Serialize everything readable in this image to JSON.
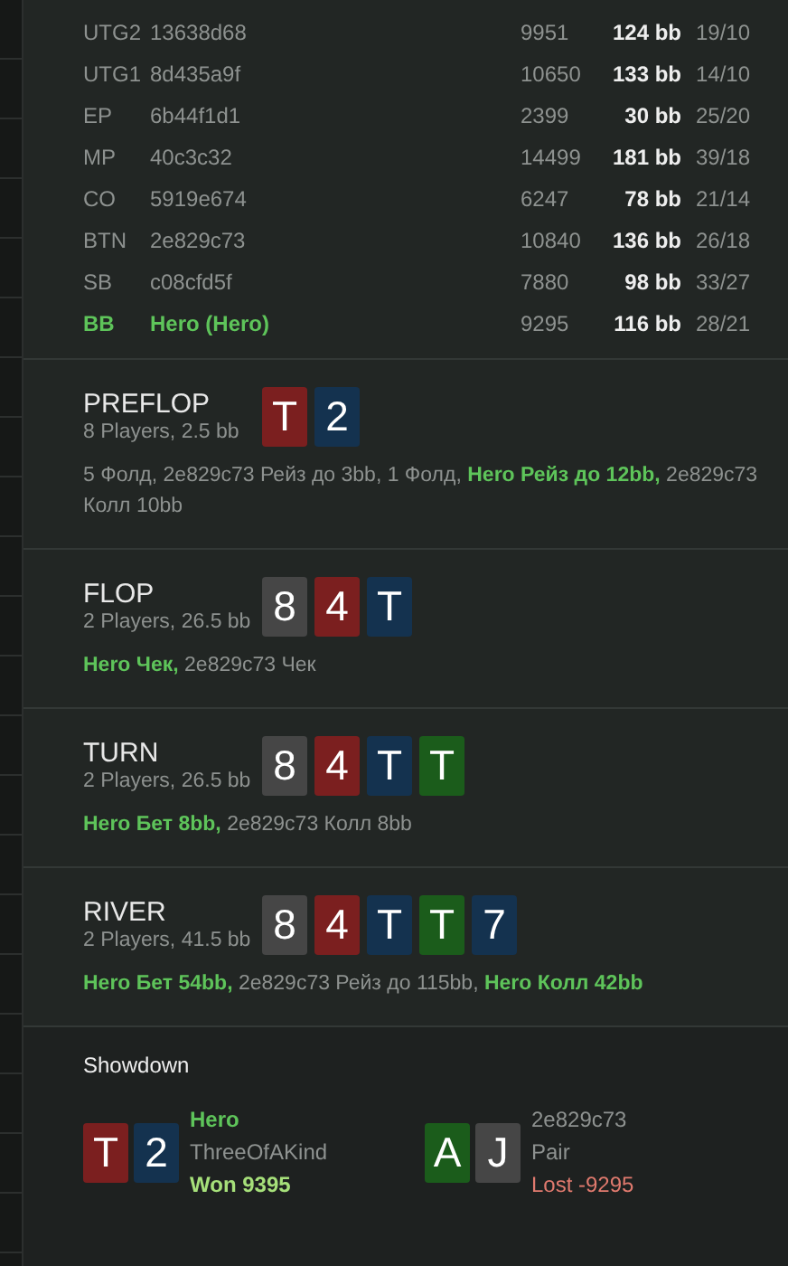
{
  "players": [
    {
      "position": "UTG2",
      "name": "13638d68",
      "chips": "9951",
      "stack": "124 bb",
      "stats": "19/10",
      "hero": false
    },
    {
      "position": "UTG1",
      "name": "8d435a9f",
      "chips": "10650",
      "stack": "133 bb",
      "stats": "14/10",
      "hero": false
    },
    {
      "position": "EP",
      "name": "6b44f1d1",
      "chips": "2399",
      "stack": "30 bb",
      "stats": "25/20",
      "hero": false
    },
    {
      "position": "MP",
      "name": "40c3c32",
      "chips": "14499",
      "stack": "181 bb",
      "stats": "39/18",
      "hero": false
    },
    {
      "position": "CO",
      "name": "5919e674",
      "chips": "6247",
      "stack": "78 bb",
      "stats": "21/14",
      "hero": false
    },
    {
      "position": "BTN",
      "name": "2e829c73",
      "chips": "10840",
      "stack": "136 bb",
      "stats": "26/18",
      "hero": false
    },
    {
      "position": "SB",
      "name": "c08cfd5f",
      "chips": "7880",
      "stack": "98 bb",
      "stats": "33/27",
      "hero": false
    },
    {
      "position": "BB",
      "name": "Hero (Hero)",
      "chips": "9295",
      "stack": "116 bb",
      "stats": "28/21",
      "hero": true
    }
  ],
  "streets": [
    {
      "title": "PREFLOP",
      "info": "8 Players, 2.5 bb",
      "cards": [
        {
          "rank": "T",
          "color": "#7b1f1f"
        },
        {
          "rank": "2",
          "color": "#14324f"
        }
      ],
      "actions": [
        {
          "text": "5 Фолд, 2e829c73 Рейз до 3bb, 1 Фолд, ",
          "hero": false
        },
        {
          "text": "Hero Рейз до 12bb, ",
          "hero": true
        },
        {
          "text": "2e829c73 Колл 10bb",
          "hero": false
        }
      ]
    },
    {
      "title": "FLOP",
      "info": "2 Players, 26.5 bb",
      "cards": [
        {
          "rank": "8",
          "color": "#464646"
        },
        {
          "rank": "4",
          "color": "#7b1f1f"
        },
        {
          "rank": "T",
          "color": "#14324f"
        }
      ],
      "actions": [
        {
          "text": "Hero Чек, ",
          "hero": true
        },
        {
          "text": "2e829c73 Чек",
          "hero": false
        }
      ]
    },
    {
      "title": "TURN",
      "info": "2 Players, 26.5 bb",
      "cards": [
        {
          "rank": "8",
          "color": "#464646"
        },
        {
          "rank": "4",
          "color": "#7b1f1f"
        },
        {
          "rank": "T",
          "color": "#14324f"
        },
        {
          "rank": "T",
          "color": "#1b5c1b"
        }
      ],
      "actions": [
        {
          "text": "Hero Бет 8bb, ",
          "hero": true
        },
        {
          "text": "2e829c73 Колл 8bb",
          "hero": false
        }
      ]
    },
    {
      "title": "RIVER",
      "info": "2 Players, 41.5 bb",
      "cards": [
        {
          "rank": "8",
          "color": "#464646"
        },
        {
          "rank": "4",
          "color": "#7b1f1f"
        },
        {
          "rank": "T",
          "color": "#14324f"
        },
        {
          "rank": "T",
          "color": "#1b5c1b"
        },
        {
          "rank": "7",
          "color": "#14324f"
        }
      ],
      "actions": [
        {
          "text": "Hero Бет 54bb, ",
          "hero": true
        },
        {
          "text": "2e829c73 Рейз до 115bb, ",
          "hero": false
        },
        {
          "text": "Hero Колл 42bb",
          "hero": true
        }
      ]
    }
  ],
  "showdown": {
    "title": "Showdown",
    "hands": [
      {
        "player": "Hero",
        "hero": true,
        "combination": "ThreeOfAKind",
        "result": "Won 9395",
        "won": true,
        "cards": [
          {
            "rank": "T",
            "color": "#7b1f1f"
          },
          {
            "rank": "2",
            "color": "#14324f"
          }
        ]
      },
      {
        "player": "2e829c73",
        "hero": false,
        "combination": "Pair",
        "result": "Lost -9295",
        "won": false,
        "cards": [
          {
            "rank": "A",
            "color": "#1b5c1b"
          },
          {
            "rank": "J",
            "color": "#464646"
          }
        ]
      }
    ]
  }
}
